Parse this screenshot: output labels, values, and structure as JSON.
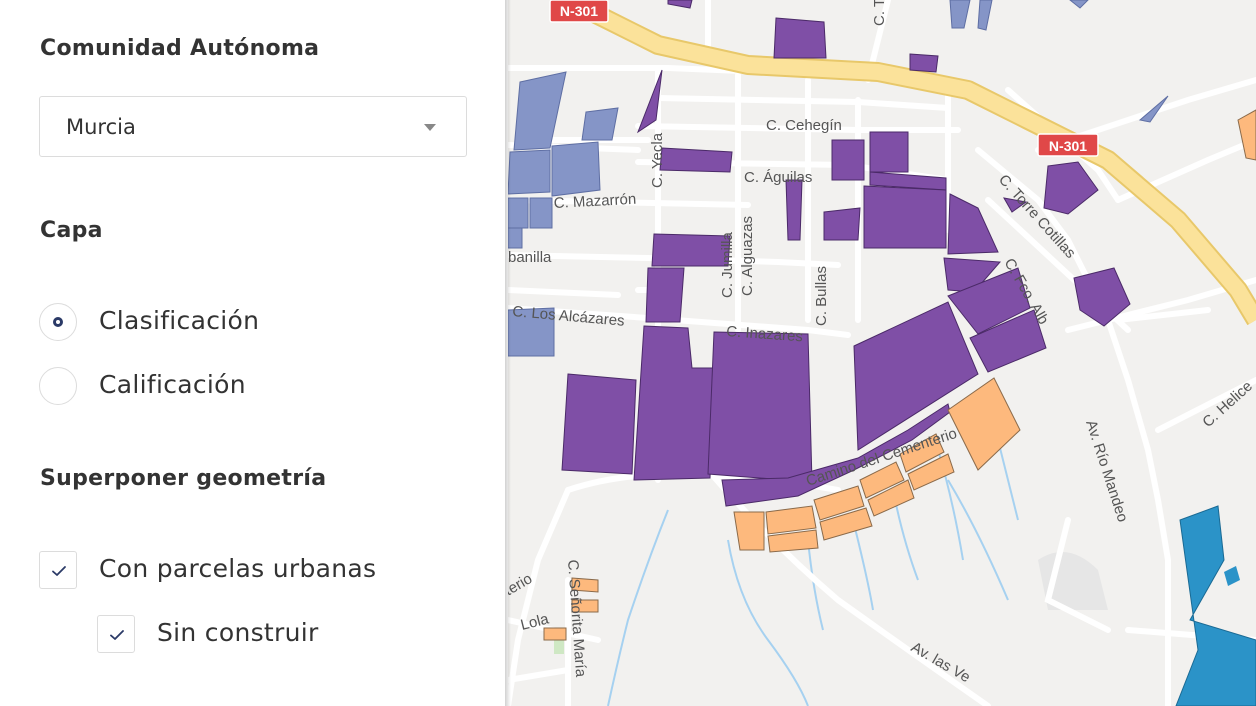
{
  "sidebar": {
    "region_title": "Comunidad Autónoma",
    "region_selected": "Murcia",
    "layer_title": "Capa",
    "layer_options": [
      "Clasificación",
      "Calificación"
    ],
    "overlay_title": "Superponer geometría",
    "overlay_urban": "Con parcelas urbanas",
    "overlay_unbuilt": "Sin construir"
  },
  "map": {
    "road_shields": [
      "N-301",
      "N-301"
    ],
    "streets": [
      "C. Cehegín",
      "C. Águilas",
      "C. Mazarrón",
      "C. Yecla",
      "C. Jumilla",
      "C. Alguazas",
      "C. Bullas",
      "banilla",
      "C. Los Alcázares",
      "C. Inazares",
      "C. Torre Cotillas",
      "C. Fco. Alb",
      "Av. Río Mandeo",
      "C. Helice",
      "Camino del Cementerio",
      "C. Señorita María",
      "Lola",
      "terio",
      "Av. las Ve",
      "C. T"
    ],
    "colors": {
      "classification_purple": "#7f4fa6",
      "urban_blue": "#8595c7",
      "orange": "#fdb97d",
      "highway": "#fbe29a",
      "shield_red": "#e04848",
      "water": "#a6d1f0",
      "cyan_zone": "#2b93c8"
    }
  }
}
